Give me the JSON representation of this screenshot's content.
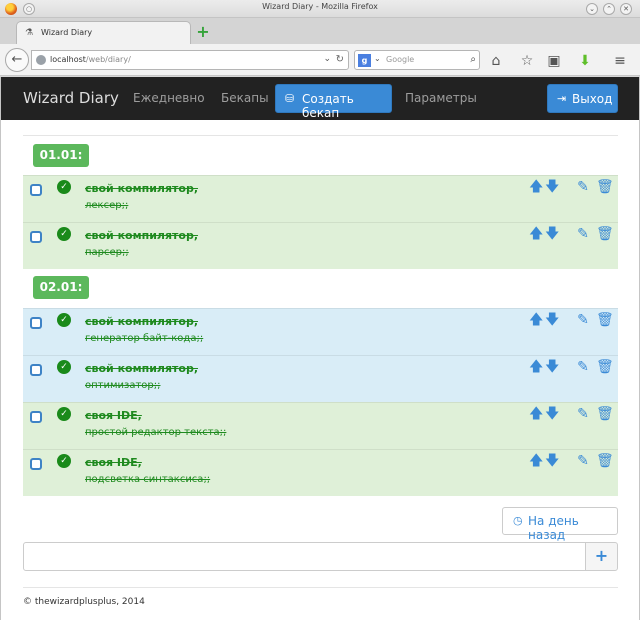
{
  "window": {
    "title": "Wizard Diary - Mozilla Firefox"
  },
  "browser": {
    "tab_title": "Wizard Diary",
    "url_host": "localhost",
    "url_path": "/web/diary/",
    "search_placeholder": "Google"
  },
  "nav": {
    "brand": "Wizard Diary",
    "daily": "Ежедневно",
    "backups": "Бекапы",
    "create_backup": "Создать бекап",
    "settings": "Параметры",
    "logout": "Выход"
  },
  "days": [
    {
      "date": "01.01:",
      "entries": [
        {
          "title": "свой компилятор,",
          "description": "лексер;;",
          "color": "#dff0d8"
        },
        {
          "title": "свой компилятор,",
          "description": "парсер;;",
          "color": "#dff0d8"
        }
      ]
    },
    {
      "date": "02.01:",
      "entries": [
        {
          "title": "свой компилятор,",
          "description": "генератор байт-кода;;",
          "color": "#d9edf7"
        },
        {
          "title": "свой компилятор,",
          "description": "оптимизатор;;",
          "color": "#d9edf7"
        },
        {
          "title": "своя IDE,",
          "description": "простой редактор текста;;",
          "color": "#dff0d8"
        },
        {
          "title": "своя IDE,",
          "description": "подсветка синтаксиса;;",
          "color": "#dff0d8"
        }
      ]
    }
  ],
  "prev_day_button": "На день назад",
  "new_entry_value": "",
  "footer": "© thewizardplusplus, 2014",
  "colors": {
    "accent": "#3a8ad6",
    "label_green": "#5cb85c",
    "done_green": "#1f8a1f",
    "navbar": "#222222"
  }
}
